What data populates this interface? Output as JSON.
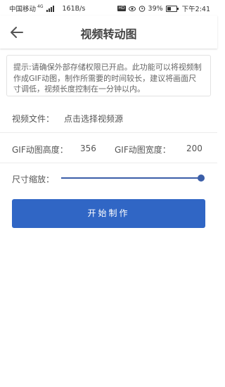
{
  "status_bar": {
    "carrier": "中国移动",
    "network": "4G",
    "speed": "161B/s",
    "hd_badge": "HD",
    "battery": "39%",
    "battery_level": 0.39,
    "time": "下午2:41"
  },
  "header": {
    "title": "视频转动图",
    "back_icon": "arrow-left-icon"
  },
  "tip": {
    "text": "提示:请确保外部存储权限已开启。此功能可以将视频制作成GIF动图，制作所需要的时间较长，建议将画面尺寸调低，视频长度控制在一分钟以内。"
  },
  "video_file": {
    "label": "视频文件：",
    "value": "点击选择视频源"
  },
  "gif_size": {
    "height_label": "GIF动图高度：",
    "height_value": "356",
    "width_label": "GIF动图宽度：",
    "width_value": "200"
  },
  "scale": {
    "label": "尺寸缩放：",
    "value_fraction": 1.0
  },
  "action": {
    "start_label": "开始制作"
  },
  "colors": {
    "accent": "#3066c5",
    "slider": "#3b5ea8"
  }
}
